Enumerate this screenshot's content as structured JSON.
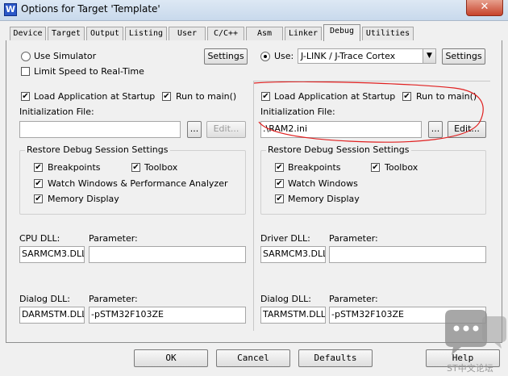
{
  "window": {
    "title": "Options for Target 'Template'",
    "icon_letter": "W",
    "close_glyph": "✕"
  },
  "tabs": [
    "Device",
    "Target",
    "Output",
    "Listing",
    "User",
    "C/C++",
    "Asm",
    "Linker",
    "Debug",
    "Utilities"
  ],
  "active_tab": "Debug",
  "left": {
    "use_simulator": {
      "label": "Use Simulator",
      "selected": false
    },
    "limit_speed": {
      "label": "Limit Speed to Real-Time",
      "checked": false
    },
    "settings_label": "Settings",
    "load_app": {
      "label": "Load Application at Startup",
      "checked": true
    },
    "run_to_main": {
      "label": "Run to main()",
      "checked": true
    },
    "init_file_label": "Initialization File:",
    "init_file_value": "",
    "browse_label": "...",
    "edit_label": "Edit...",
    "restore_title": "Restore Debug Session Settings",
    "breakpoints": "Breakpoints",
    "toolbox": "Toolbox",
    "watch": "Watch Windows & Performance Analyzer",
    "memory": "Memory Display",
    "cpu_dll_label": "CPU DLL:",
    "cpu_dll_value": "SARMCM3.DLL",
    "param_label": "Parameter:",
    "cpu_param_value": "",
    "dialog_dll_label": "Dialog DLL:",
    "dialog_dll_value": "DARMSTM.DLL",
    "dialog_param_value": "-pSTM32F103ZE"
  },
  "right": {
    "use_label": "Use:",
    "use_selected": true,
    "driver_value": "J-LINK / J-Trace Cortex",
    "settings_label": "Settings",
    "load_app": {
      "label": "Load Application at Startup",
      "checked": true
    },
    "run_to_main": {
      "label": "Run to main()",
      "checked": true
    },
    "init_file_label": "Initialization File:",
    "init_file_value": ".\\RAM2.ini",
    "browse_label": "...",
    "edit_label": "Edit...",
    "restore_title": "Restore Debug Session Settings",
    "breakpoints": "Breakpoints",
    "toolbox": "Toolbox",
    "watch": "Watch Windows",
    "memory": "Memory Display",
    "driver_dll_label": "Driver DLL:",
    "driver_dll_value": "SARMCM3.DLL",
    "param_label": "Parameter:",
    "driver_param_value": "",
    "dialog_dll_label": "Dialog DLL:",
    "dialog_dll_value": "TARMSTM.DLL",
    "dialog_param_value": "-pSTM32F103ZE"
  },
  "footer": {
    "ok": "OK",
    "cancel": "Cancel",
    "defaults": "Defaults",
    "help": "Help"
  },
  "check_glyph": "✔",
  "dropdown_glyph": "▼",
  "colors": {
    "annotation": "#e02020",
    "title_gradient_top": "#dde8f4",
    "dialog_bg": "#f0f0f0"
  }
}
